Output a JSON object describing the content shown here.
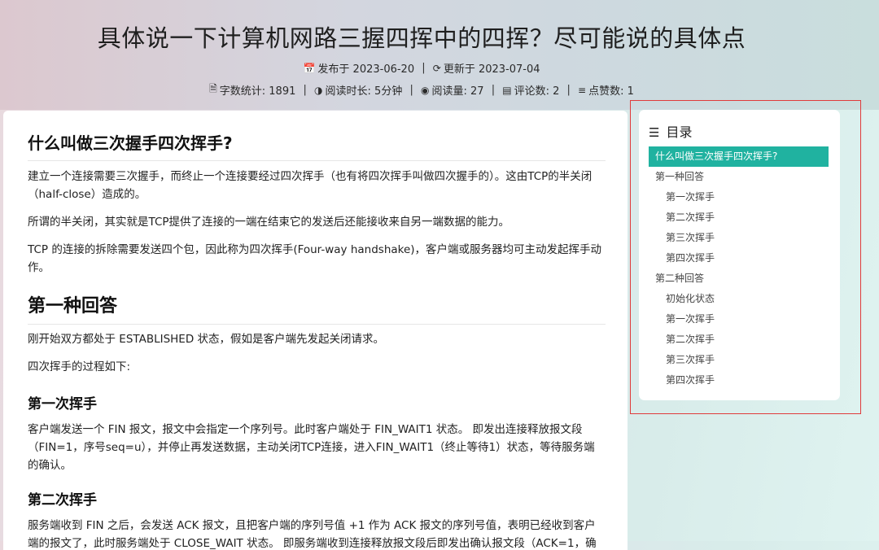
{
  "header": {
    "title": "具体说一下计算机网路三握四挥中的四挥？尽可能说的具体点",
    "published_icon": "calendar-icon",
    "published": "发布于 2023-06-20",
    "updated_icon": "refresh-icon",
    "updated": "更新于 2023-07-04",
    "word_count_icon": "document-icon",
    "word_count": "字数统计: 1891",
    "read_time_icon": "clock-icon",
    "read_time": "阅读时长: 5分钟",
    "views_icon": "eye-icon",
    "views": "阅读量: 27",
    "comments_icon": "comment-icon",
    "comments": "评论数: 2",
    "likes_icon": "menu-icon",
    "likes": "点赞数: 1",
    "separator": "|"
  },
  "article": {
    "h_what": "什么叫做三次握手四次挥手?",
    "p1": "建立一个连接需要三次握手，而终止一个连接要经过四次挥手（也有将四次挥手叫做四次握手的）。这由TCP的半关闭（half-close）造成的。",
    "p2": "所谓的半关闭，其实就是TCP提供了连接的一端在结束它的发送后还能接收来自另一端数据的能力。",
    "p3": "TCP 的连接的拆除需要发送四个包，因此称为四次挥手(Four-way handshake)，客户端或服务器均可主动发起挥手动作。",
    "h_answer1": "第一种回答",
    "p4": "刚开始双方都处于 ESTABLISHED 状态，假如是客户端先发起关闭请求。",
    "p5": "四次挥手的过程如下:",
    "h_first": "第一次挥手",
    "p6": "客户端发送一个 FIN 报文，报文中会指定一个序列号。此时客户端处于 FIN_WAIT1 状态。 即发出连接释放报文段（FIN=1，序号seq=u），并停止再发送数据，主动关闭TCP连接，进入FIN_WAIT1（终止等待1）状态，等待服务端的确认。",
    "h_second": "第二次挥手",
    "p7": "服务端收到 FIN 之后，会发送 ACK 报文，且把客户端的序列号值 +1 作为 ACK 报文的序列号值，表明已经收到客户端的报文了，此时服务端处于 CLOSE_WAIT 状态。 即服务端收到连接释放报文段后即发出确认报文段（ACK=1，确"
  },
  "toc": {
    "icon": "list-icon",
    "title": "目录",
    "items": [
      {
        "label": "什么叫做三次握手四次挥手?",
        "level": 1,
        "active": true
      },
      {
        "label": "第一种回答",
        "level": 1,
        "active": false
      },
      {
        "label": "第一次挥手",
        "level": 2,
        "active": false
      },
      {
        "label": "第二次挥手",
        "level": 2,
        "active": false
      },
      {
        "label": "第三次挥手",
        "level": 2,
        "active": false
      },
      {
        "label": "第四次挥手",
        "level": 2,
        "active": false
      },
      {
        "label": "第二种回答",
        "level": 1,
        "active": false
      },
      {
        "label": "初始化状态",
        "level": 2,
        "active": false
      },
      {
        "label": "第一次挥手",
        "level": 2,
        "active": false
      },
      {
        "label": "第二次挥手",
        "level": 2,
        "active": false
      },
      {
        "label": "第三次挥手",
        "level": 2,
        "active": false
      },
      {
        "label": "第四次挥手",
        "level": 2,
        "active": false
      }
    ]
  },
  "colors": {
    "toc_active_bg": "#20b2a0",
    "highlight_border": "#e03b3b"
  }
}
